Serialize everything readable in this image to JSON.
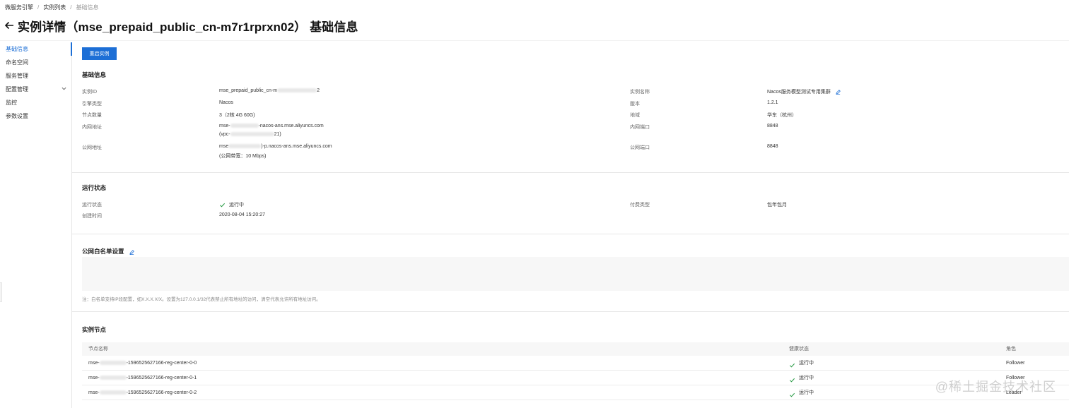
{
  "breadcrumb": [
    "微服务引擎",
    "实例列表",
    "基础信息"
  ],
  "title": "实例详情（mse_prepaid_public_cn-m7r1rprxn02） 基础信息",
  "sidebar": {
    "items": [
      {
        "label": "基础信息"
      },
      {
        "label": "命名空间"
      },
      {
        "label": "服务管理"
      },
      {
        "label": "配置管理"
      },
      {
        "label": "监控"
      },
      {
        "label": "参数设置"
      }
    ]
  },
  "toolbar": {
    "restart_label": "重启实例"
  },
  "basic": {
    "title": "基础信息",
    "instance_id_label": "实例ID",
    "instance_id_value": "mse_prepaid_public_cn-m",
    "instance_id_suffix": "2",
    "engine_label": "引擎类型",
    "engine_value": "Nacos",
    "nodes_label": "节点数量",
    "nodes_value": "3（2核 4G 60G)",
    "intranet_label": "内网地址",
    "intranet_value_1_pre": "mse-",
    "intranet_value_1_post": "-nacos-ans.mse.aliyuncs.com",
    "intranet_value_2_pre": "(vpc-",
    "intranet_value_2_post": "21)",
    "public_label": "公网地址",
    "public_value_pre": "mse",
    "public_value_post": ")-p.nacos-ans.mse.aliyuncs.com",
    "public_bandwidth": "(公网带宽：10 Mbps)",
    "name_label": "实例名称",
    "name_value": "Nacos服务模型测试专用集群",
    "version_label": "版本",
    "version_value": "1.2.1",
    "region_label": "地域",
    "region_value": "华东（杭州）",
    "intranet_port_label": "内网端口",
    "intranet_port_value": "8848",
    "public_port_label": "公网端口",
    "public_port_value": "8848"
  },
  "status": {
    "title": "运行状态",
    "run_label": "运行状态",
    "run_value": "运行中",
    "created_label": "创建时间",
    "created_value": "2020-08-04 15:20:27",
    "pay_label": "付费类型",
    "pay_value": "包年包月"
  },
  "whitelist": {
    "title": "公网白名单设置",
    "note": "注：白名单支持IP段配置，如X.X.X.X/X。设置为127.0.0.1/32代表禁止所有地址的访问，清空代表允许所有地址访问。"
  },
  "nodes": {
    "title": "实例节点",
    "headers": [
      "节点名称",
      "健康状态",
      "角色"
    ],
    "rows": [
      {
        "name_pre": "mse-",
        "name_post": "-1596525627166-reg-center-0-0",
        "health": "运行中",
        "role": "Follower"
      },
      {
        "name_pre": "mse-",
        "name_post": "-1596525627166-reg-center-0-1",
        "health": "运行中",
        "role": "Follower"
      },
      {
        "name_pre": "mse-",
        "name_post": "-1596525627166-reg-center-0-2",
        "health": "运行中",
        "role": "Leader"
      }
    ]
  },
  "watermark": "@稀土掘金技术社区",
  "colors": {
    "primary": "#1d6fd6",
    "success": "#2e9e4a"
  }
}
